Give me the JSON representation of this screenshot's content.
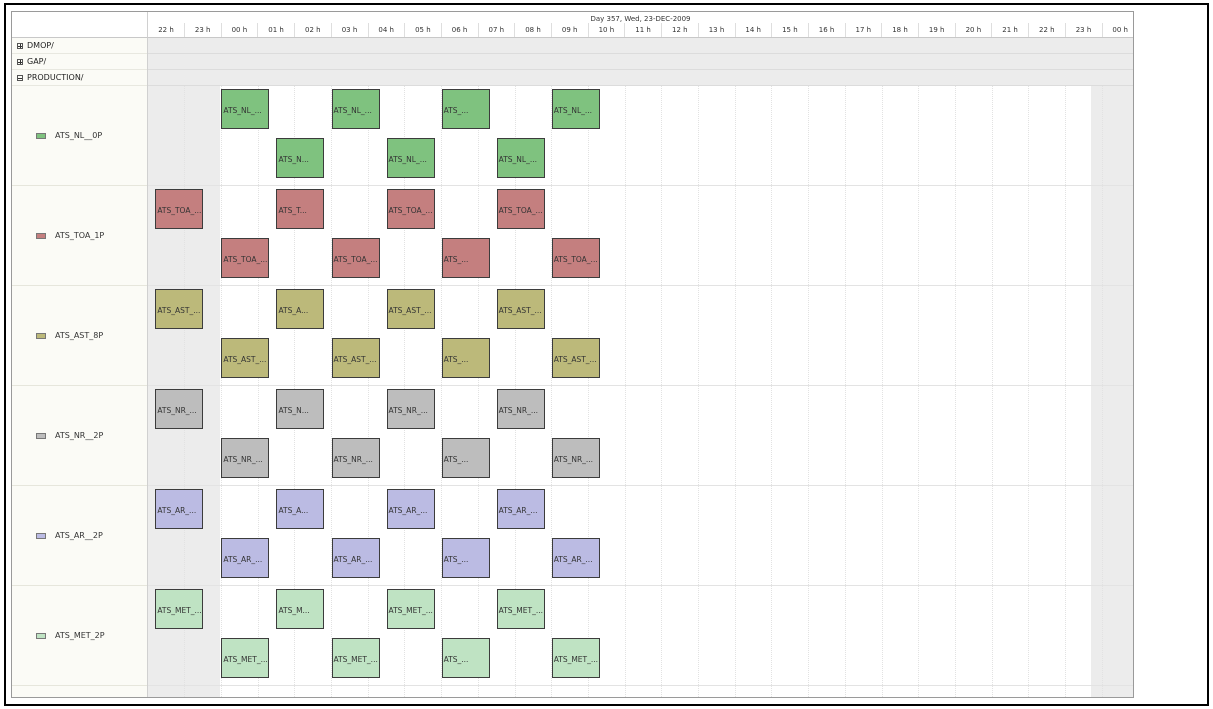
{
  "header": {
    "day_label": "Day 357, Wed, 23-DEC-2009",
    "hours": [
      "22 h",
      "23 h",
      "00 h",
      "01 h",
      "02 h",
      "03 h",
      "04 h",
      "05 h",
      "06 h",
      "07 h",
      "08 h",
      "09 h",
      "10 h",
      "11 h",
      "12 h",
      "13 h",
      "14 h",
      "15 h",
      "16 h",
      "17 h",
      "18 h",
      "19 h",
      "20 h",
      "21 h",
      "22 h",
      "23 h",
      "00 h"
    ]
  },
  "groups": [
    {
      "label": "DMOP/",
      "expanded": false
    },
    {
      "label": "GAP/",
      "expanded": false
    },
    {
      "label": "PRODUCTION/",
      "expanded": true
    }
  ],
  "resources": [
    {
      "label": "ATS_NL__0P",
      "color": "#7fc27f",
      "top": [
        {
          "start": 0,
          "label": "ATS_NL_..."
        },
        {
          "start": 3,
          "label": "ATS_NL_..."
        },
        {
          "start": 6,
          "label": "ATS_..."
        },
        {
          "start": 9,
          "label": "ATS_NL_..."
        }
      ],
      "bottom": [
        {
          "start": 1.5,
          "label": "ATS_N..."
        },
        {
          "start": 4.5,
          "label": "ATS_NL_..."
        },
        {
          "start": 7.5,
          "label": "ATS_NL_..."
        }
      ]
    },
    {
      "label": "ATS_TOA_1P",
      "color": "#c47f7f",
      "top": [
        {
          "start": -1.8,
          "label": "ATS_TOA_..."
        },
        {
          "start": 1.5,
          "label": "ATS_T..."
        },
        {
          "start": 4.5,
          "label": "ATS_TOA_..."
        },
        {
          "start": 7.5,
          "label": "ATS_TOA_..."
        }
      ],
      "bottom": [
        {
          "start": 0,
          "label": "ATS_TOA_..."
        },
        {
          "start": 3,
          "label": "ATS_TOA_..."
        },
        {
          "start": 6,
          "label": "ATS_..."
        },
        {
          "start": 9,
          "label": "ATS_TOA_..."
        }
      ]
    },
    {
      "label": "ATS_AST_8P",
      "color": "#bcb97a",
      "top": [
        {
          "start": -1.8,
          "label": "ATS_AST_..."
        },
        {
          "start": 1.5,
          "label": "ATS_A..."
        },
        {
          "start": 4.5,
          "label": "ATS_AST_..."
        },
        {
          "start": 7.5,
          "label": "ATS_AST_..."
        }
      ],
      "bottom": [
        {
          "start": 0,
          "label": "ATS_AST_..."
        },
        {
          "start": 3,
          "label": "ATS_AST_..."
        },
        {
          "start": 6,
          "label": "ATS_..."
        },
        {
          "start": 9,
          "label": "ATS_AST_..."
        }
      ]
    },
    {
      "label": "ATS_NR__2P",
      "color": "#bdbdbd",
      "top": [
        {
          "start": -1.8,
          "label": "ATS_NR_..."
        },
        {
          "start": 1.5,
          "label": "ATS_N..."
        },
        {
          "start": 4.5,
          "label": "ATS_NR_..."
        },
        {
          "start": 7.5,
          "label": "ATS_NR_..."
        }
      ],
      "bottom": [
        {
          "start": 0,
          "label": "ATS_NR_..."
        },
        {
          "start": 3,
          "label": "ATS_NR_..."
        },
        {
          "start": 6,
          "label": "ATS_..."
        },
        {
          "start": 9,
          "label": "ATS_NR_..."
        }
      ]
    },
    {
      "label": "ATS_AR__2P",
      "color": "#bbbbe3",
      "top": [
        {
          "start": -1.8,
          "label": "ATS_AR_..."
        },
        {
          "start": 1.5,
          "label": "ATS_A..."
        },
        {
          "start": 4.5,
          "label": "ATS_AR_..."
        },
        {
          "start": 7.5,
          "label": "ATS_AR_..."
        }
      ],
      "bottom": [
        {
          "start": 0,
          "label": "ATS_AR_..."
        },
        {
          "start": 3,
          "label": "ATS_AR_..."
        },
        {
          "start": 6,
          "label": "ATS_..."
        },
        {
          "start": 9,
          "label": "ATS_AR_..."
        }
      ]
    },
    {
      "label": "ATS_MET_2P",
      "color": "#bfe3c3",
      "top": [
        {
          "start": -1.8,
          "label": "ATS_MET_..."
        },
        {
          "start": 1.5,
          "label": "ATS_M..."
        },
        {
          "start": 4.5,
          "label": "ATS_MET_..."
        },
        {
          "start": 7.5,
          "label": "ATS_MET_..."
        }
      ],
      "bottom": [
        {
          "start": 0,
          "label": "ATS_MET_..."
        },
        {
          "start": 3,
          "label": "ATS_MET_..."
        },
        {
          "start": 6,
          "label": "ATS_..."
        },
        {
          "start": 9,
          "label": "ATS_MET_..."
        }
      ]
    }
  ]
}
